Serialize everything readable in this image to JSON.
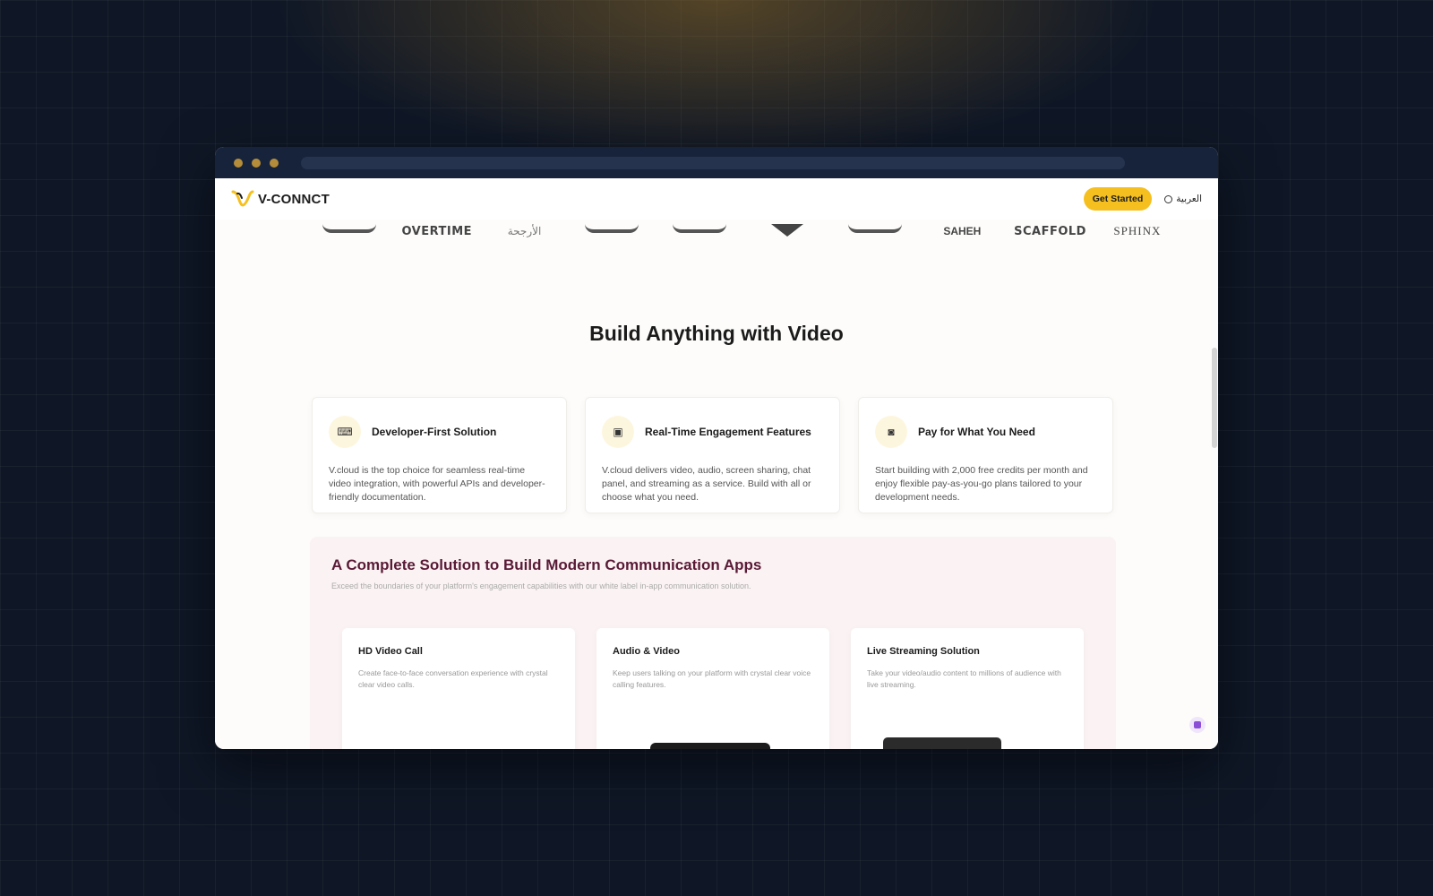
{
  "nav": {
    "logo_text": "V-CONNCT",
    "cta": "Get Started",
    "language": "العربية"
  },
  "brand_logos": [
    "",
    "OVERTIME",
    "الأرجحة",
    "",
    "",
    "",
    "",
    "SAHEH",
    "SCAFFOLD",
    "SPHINX"
  ],
  "hero": {
    "title": "Build Anything with Video"
  },
  "features": [
    {
      "icon": "developer-icon",
      "title": "Developer-First Solution",
      "description": "V.cloud is the top choice for seamless real-time video integration, with powerful APIs and developer-friendly documentation."
    },
    {
      "icon": "engagement-icon",
      "title": "Real-Time Engagement Features",
      "description": "V.cloud delivers video, audio, screen sharing, chat panel, and streaming as a service. Build with all or choose what you need."
    },
    {
      "icon": "payment-icon",
      "title": "Pay for What You Need",
      "description": "Start building with 2,000 free credits per month and enjoy flexible pay-as-you-go plans tailored to your development needs."
    }
  ],
  "solution": {
    "title": "A Complete Solution to Build Modern Communication Apps",
    "subtitle": "Exceed the boundaries of your platform's engagement capabilities with our white label in-app communication solution.",
    "cards": [
      {
        "title": "HD Video Call",
        "description": "Create face-to-face conversation experience with crystal clear video calls."
      },
      {
        "title": "Audio & Video",
        "description": "Keep users talking on your platform with crystal clear voice calling features."
      },
      {
        "title": "Live Streaming Solution",
        "description": "Take your video/audio content to millions of audience with live streaming."
      }
    ]
  },
  "colors": {
    "accent": "#f5c01f",
    "solution_title": "#5a1a36",
    "page_bg": "#0f1726"
  }
}
